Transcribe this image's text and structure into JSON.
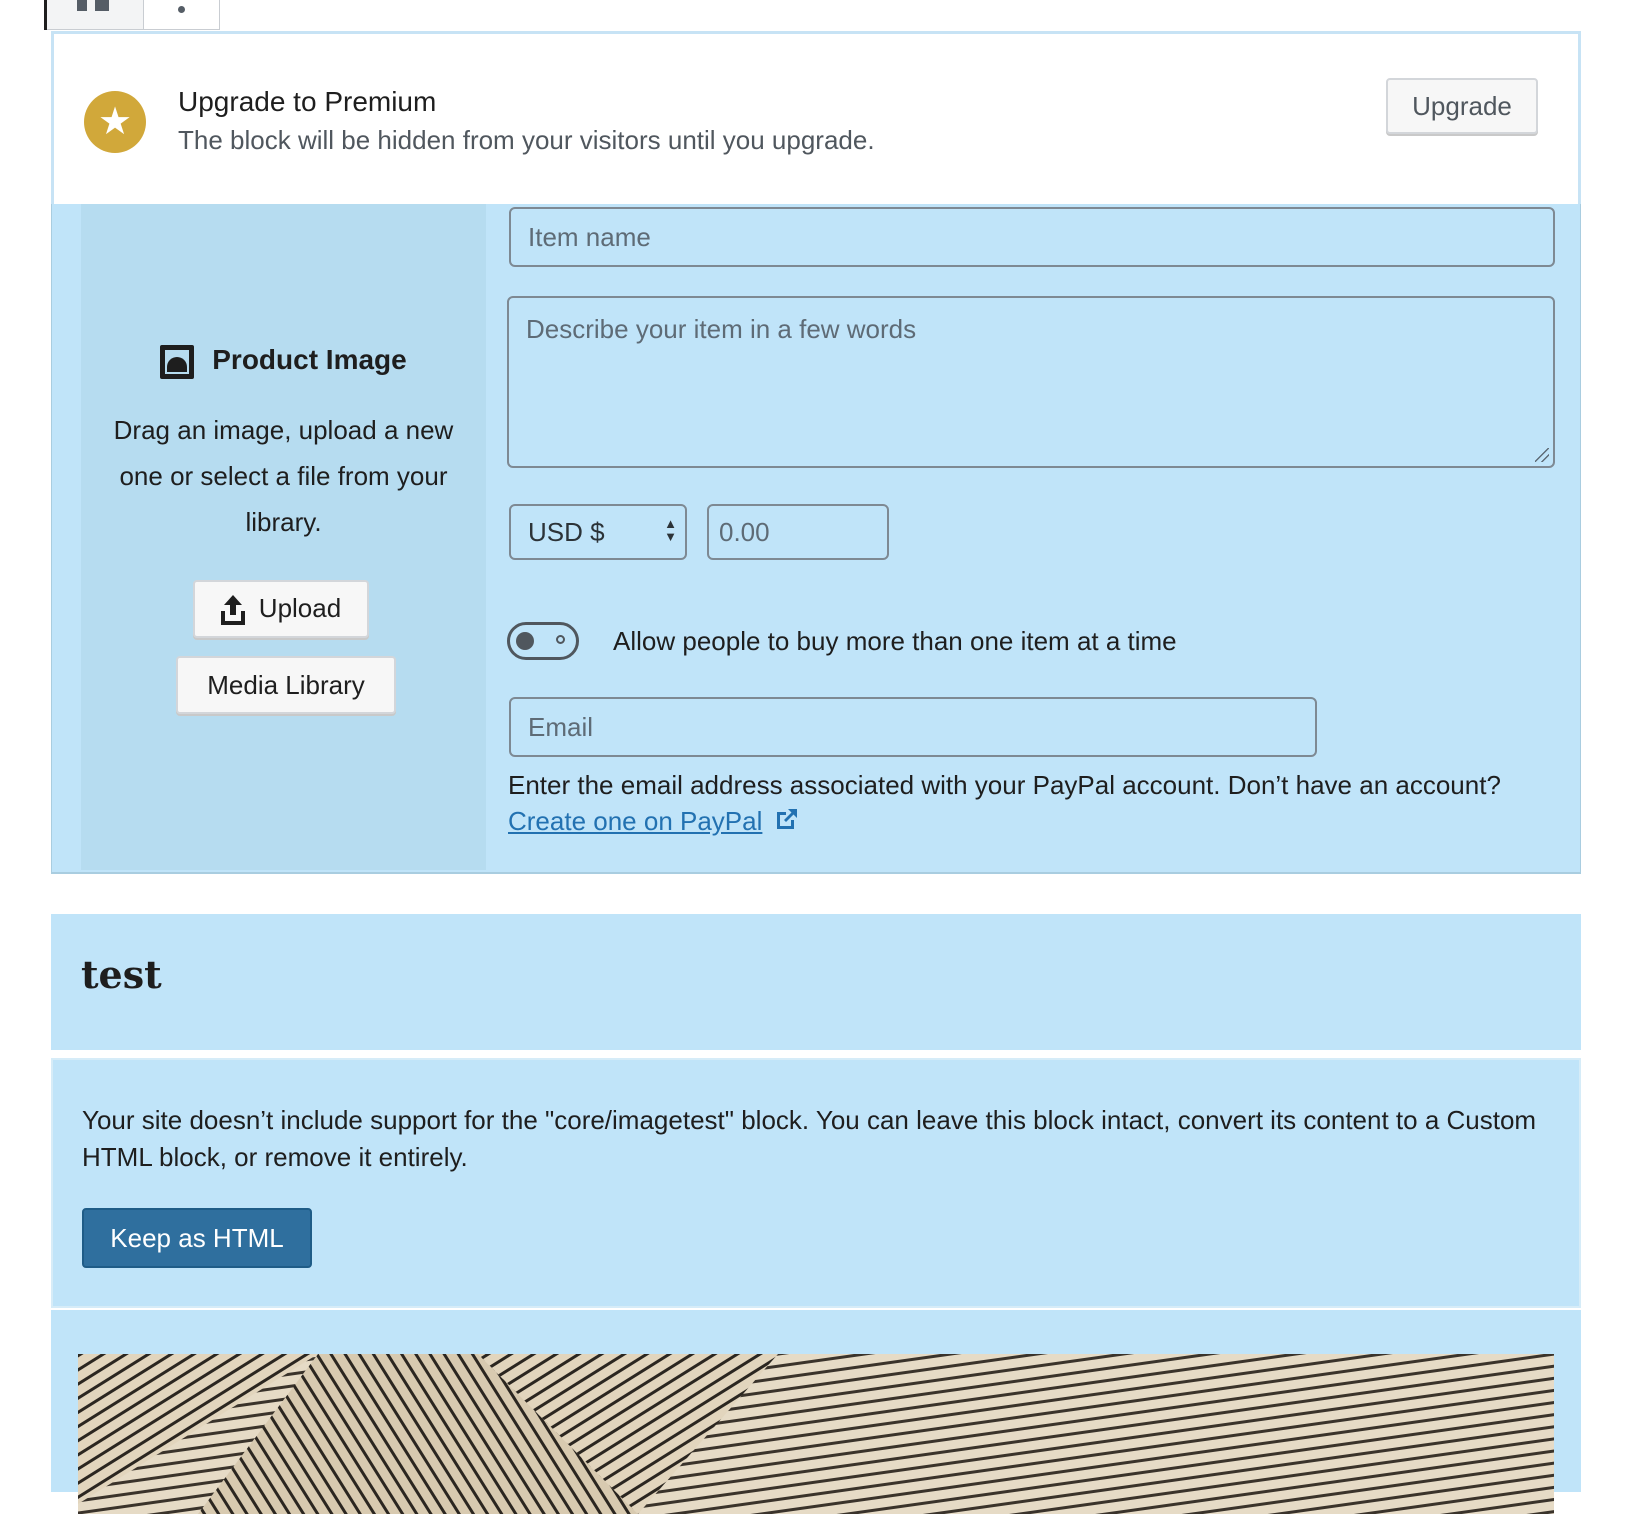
{
  "nudge": {
    "title": "Upgrade to Premium",
    "description": "The block will be hidden from your visitors until you upgrade.",
    "upgrade_label": "Upgrade"
  },
  "payments": {
    "media": {
      "heading": "Product Image",
      "instructions": "Drag an image, upload a new one or select a file from your library.",
      "upload_label": "Upload",
      "media_library_label": "Media Library"
    },
    "item_name_placeholder": "Item name",
    "description_placeholder": "Describe your item in a few words",
    "currency_value": "USD $",
    "price_placeholder": "0.00",
    "toggle_label": "Allow people to buy more than one item at a time",
    "toggle_on": false,
    "email_placeholder": "Email",
    "email_help": "Enter the email address associated with your PayPal account. Don’t have an account?",
    "paypal_link": "Create one on PayPal"
  },
  "heading_block": {
    "text": "test"
  },
  "missing_block": {
    "message": "Your site doesn’t include support for the \"core/imagetest\" block. You can leave this block intact, convert its content to a Custom HTML block, or remove it entirely.",
    "keep_label": "Keep as HTML"
  },
  "colors": {
    "accent_gold": "#d1a83a",
    "block_bg": "#c0e4f9",
    "primary_button": "#2f6f9e",
    "link": "#2271b1"
  },
  "icons": [
    "block-align-icon",
    "more-dot-icon",
    "star-icon",
    "image-icon",
    "upload-icon",
    "external-link-icon",
    "select-arrows-icon"
  ]
}
